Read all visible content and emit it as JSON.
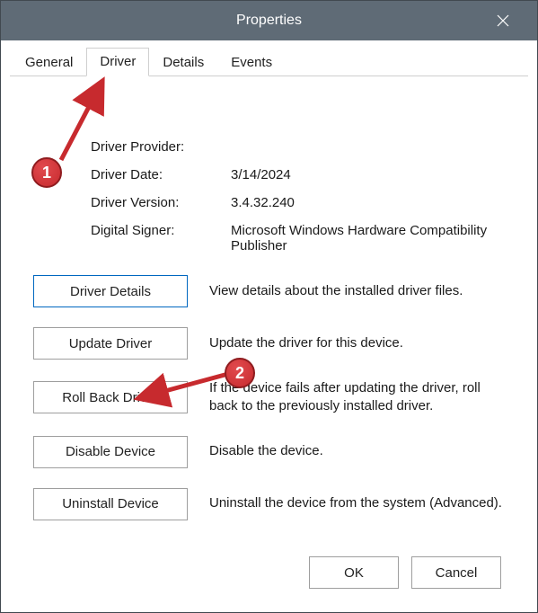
{
  "window": {
    "title": "Properties"
  },
  "tabs": {
    "general": "General",
    "driver": "Driver",
    "details": "Details",
    "events": "Events",
    "active": "driver"
  },
  "info": {
    "provider_label": "Driver Provider:",
    "provider_value": "",
    "date_label": "Driver Date:",
    "date_value": "3/14/2024",
    "version_label": "Driver Version:",
    "version_value": "3.4.32.240",
    "signer_label": "Digital Signer:",
    "signer_value": "Microsoft Windows Hardware Compatibility Publisher"
  },
  "actions": {
    "driver_details": {
      "label": "Driver Details",
      "desc": "View details about the installed driver files."
    },
    "update_driver": {
      "label": "Update Driver",
      "desc": "Update the driver for this device."
    },
    "roll_back": {
      "label": "Roll Back Driver",
      "desc": "If the device fails after updating the driver, roll back to the previously installed driver."
    },
    "disable_device": {
      "label": "Disable Device",
      "desc": "Disable the device."
    },
    "uninstall_device": {
      "label": "Uninstall Device",
      "desc": "Uninstall the device from the system (Advanced)."
    }
  },
  "buttons": {
    "ok": "OK",
    "cancel": "Cancel"
  },
  "annotations": {
    "marker1": "1",
    "marker2": "2"
  }
}
